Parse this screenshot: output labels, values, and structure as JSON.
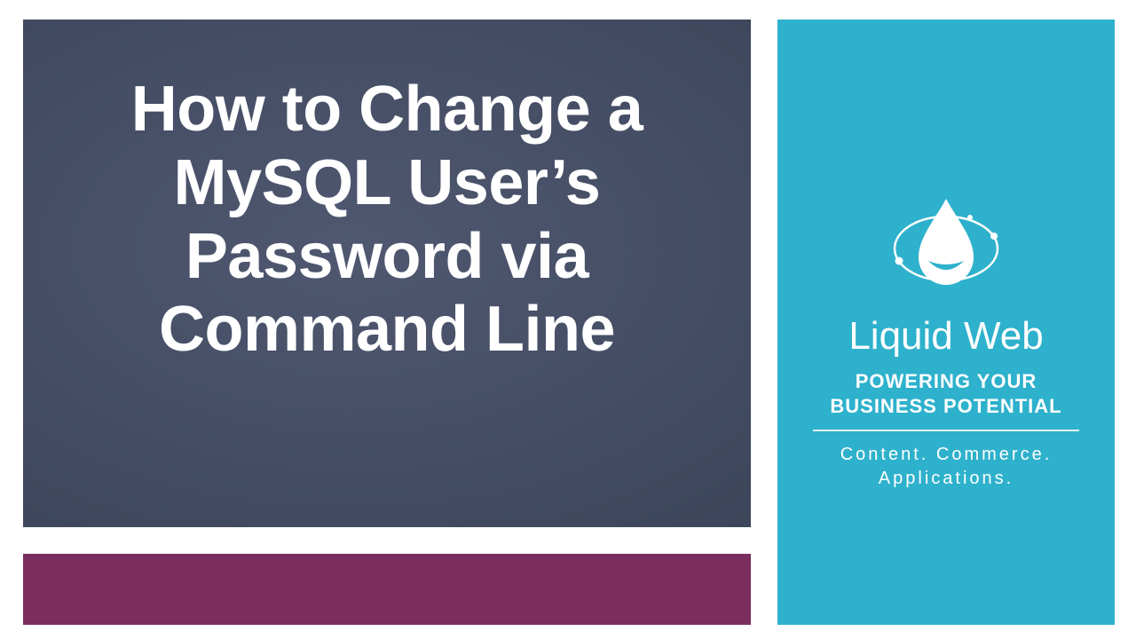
{
  "main": {
    "title": "How to Change a MySQL User’s Password via Command Line"
  },
  "sidebar": {
    "brand": "Liquid Web",
    "tagline1_line1": "POWERING YOUR",
    "tagline1_line2": "BUSINESS POTENTIAL",
    "tagline2_line1": "Content. Commerce.",
    "tagline2_line2": "Applications."
  },
  "colors": {
    "panel_bg": "#414a60",
    "accent_bar": "#7b2e5e",
    "sidebar_bg": "#2eb1cc",
    "text_white": "#ffffff"
  }
}
